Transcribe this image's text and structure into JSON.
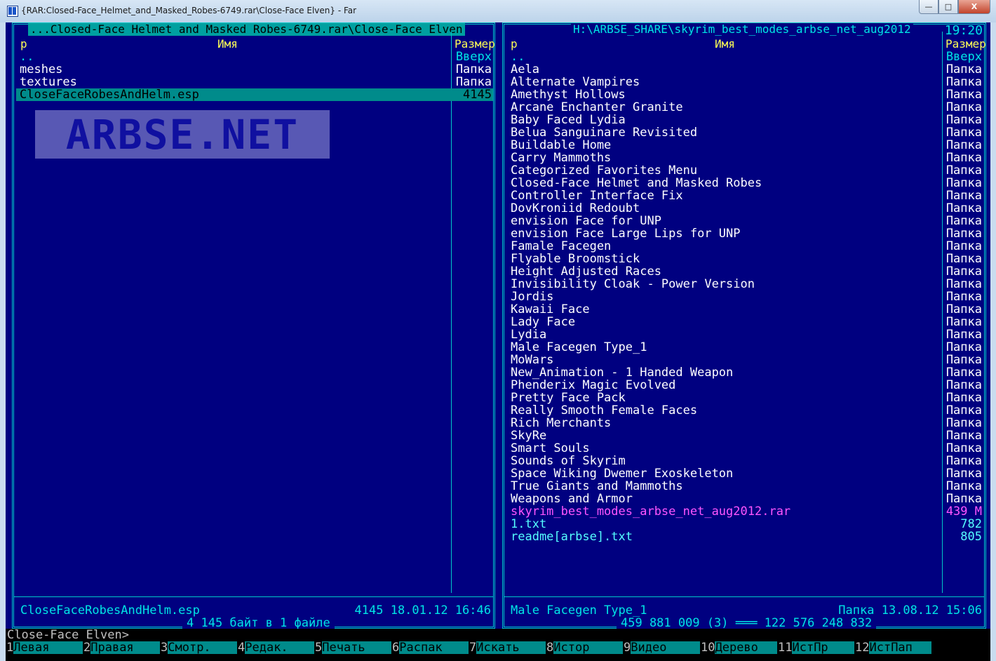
{
  "window": {
    "title": "{RAR:Closed-Face_Helmet_and_Masked_Robes-6749.rar\\Close-Face Elven} - Far",
    "buttons": {
      "minimize": "—",
      "maximize": "□",
      "close": "X"
    }
  },
  "clock": "19:20",
  "left_panel": {
    "path": " ...Closed-Face Helmet and Masked Robes-6749.rar\\Close-Face Elven",
    "header": {
      "sort": "р",
      "name": "Имя",
      "size": "Размер"
    },
    "items": [
      {
        "name": "..",
        "size": "Вверх",
        "kind": "up"
      },
      {
        "name": "meshes",
        "size": "Папка",
        "kind": "dir"
      },
      {
        "name": "textures",
        "size": "Папка",
        "kind": "dir"
      },
      {
        "name": "CloseFaceRobesAndHelm.esp",
        "size": "4145",
        "kind": "sel"
      }
    ],
    "status_name": "CloseFaceRobesAndHelm.esp",
    "status_info": "4145 18.01.12 16:46",
    "summary": "4 145 байт в 1 файле",
    "watermark": "ARBSE.NET"
  },
  "right_panel": {
    "path": " H:\\ARBSE_SHARE\\skyrim_best_modes_arbse_net_aug2012 ",
    "header": {
      "sort": "р",
      "name": "Имя",
      "size": "Размер"
    },
    "items": [
      {
        "name": "..",
        "size": "Вверх",
        "kind": "up"
      },
      {
        "name": "Aela",
        "size": "Папка",
        "kind": "dir"
      },
      {
        "name": "Alternate Vampires",
        "size": "Папка",
        "kind": "dir"
      },
      {
        "name": "Amethyst Hollows",
        "size": "Папка",
        "kind": "dir"
      },
      {
        "name": "Arcane Enchanter Granite",
        "size": "Папка",
        "kind": "dir"
      },
      {
        "name": "Baby Faced Lydia",
        "size": "Папка",
        "kind": "dir"
      },
      {
        "name": "Belua Sanguinare Revisited",
        "size": "Папка",
        "kind": "dir"
      },
      {
        "name": "Buildable Home",
        "size": "Папка",
        "kind": "dir"
      },
      {
        "name": "Carry Mammoths",
        "size": "Папка",
        "kind": "dir"
      },
      {
        "name": "Categorized Favorites Menu",
        "size": "Папка",
        "kind": "dir"
      },
      {
        "name": "Closed-Face Helmet and Masked Robes",
        "size": "Папка",
        "kind": "dir"
      },
      {
        "name": "Controller Interface Fix",
        "size": "Папка",
        "kind": "dir"
      },
      {
        "name": "DovKroniid Redoubt",
        "size": "Папка",
        "kind": "dir"
      },
      {
        "name": "envision Face for UNP",
        "size": "Папка",
        "kind": "dir"
      },
      {
        "name": "envision Face Large Lips for UNP",
        "size": "Папка",
        "kind": "dir"
      },
      {
        "name": "Famale Facegen",
        "size": "Папка",
        "kind": "dir"
      },
      {
        "name": "Flyable Broomstick",
        "size": "Папка",
        "kind": "dir"
      },
      {
        "name": "Height Adjusted Races",
        "size": "Папка",
        "kind": "dir"
      },
      {
        "name": "Invisibility Cloak - Power Version",
        "size": "Папка",
        "kind": "dir"
      },
      {
        "name": "Jordis",
        "size": "Папка",
        "kind": "dir"
      },
      {
        "name": "Kawaii Face",
        "size": "Папка",
        "kind": "dir"
      },
      {
        "name": "Lady Face",
        "size": "Папка",
        "kind": "dir"
      },
      {
        "name": "Lydia",
        "size": "Папка",
        "kind": "dir"
      },
      {
        "name": "Male Facegen Type_1",
        "size": "Папка",
        "kind": "dir"
      },
      {
        "name": "MoWars",
        "size": "Папка",
        "kind": "dir"
      },
      {
        "name": "New_Animation - 1 Handed Weapon",
        "size": "Папка",
        "kind": "dir"
      },
      {
        "name": "Phenderix Magic Evolved",
        "size": "Папка",
        "kind": "dir"
      },
      {
        "name": "Pretty Face Pack",
        "size": "Папка",
        "kind": "dir"
      },
      {
        "name": "Really Smooth Female Faces",
        "size": "Папка",
        "kind": "dir"
      },
      {
        "name": "Rich Merchants",
        "size": "Папка",
        "kind": "dir"
      },
      {
        "name": "SkyRe",
        "size": "Папка",
        "kind": "dir"
      },
      {
        "name": "Smart Souls",
        "size": "Папка",
        "kind": "dir"
      },
      {
        "name": "Sounds of Skyrim",
        "size": "Папка",
        "kind": "dir"
      },
      {
        "name": "Space Wiking Dwemer Exoskeleton",
        "size": "Папка",
        "kind": "dir"
      },
      {
        "name": "True Giants and Mammoths",
        "size": "Папка",
        "kind": "dir"
      },
      {
        "name": "Weapons and Armor",
        "size": "Папка",
        "kind": "dir"
      },
      {
        "name": "skyrim_best_modes_arbse_net_aug2012.rar",
        "size": "439 M",
        "kind": "arch"
      },
      {
        "name": "1.txt",
        "size": "782",
        "kind": "file"
      },
      {
        "name": "readme[arbse].txt",
        "size": "805",
        "kind": "file"
      }
    ],
    "status_name": "Male Facegen Type_1",
    "status_info": "Папка 13.08.12 15:06",
    "summary": "459 881 009 (3) ═══ 122 576 248 832"
  },
  "command_line": "Close-Face Elven>",
  "keybar": [
    {
      "num": "1",
      "label": "Левая"
    },
    {
      "num": "2",
      "label": "Правая"
    },
    {
      "num": "3",
      "label": "Смотр."
    },
    {
      "num": "4",
      "label": "Редак."
    },
    {
      "num": "5",
      "label": "Печать"
    },
    {
      "num": "6",
      "label": "Распак"
    },
    {
      "num": "7",
      "label": "Искать"
    },
    {
      "num": "8",
      "label": "Истор"
    },
    {
      "num": "9",
      "label": "Видео"
    },
    {
      "num": "10",
      "label": "Дерево"
    },
    {
      "num": "11",
      "label": "ИстПр"
    },
    {
      "num": "12",
      "label": "ИстПап"
    }
  ]
}
